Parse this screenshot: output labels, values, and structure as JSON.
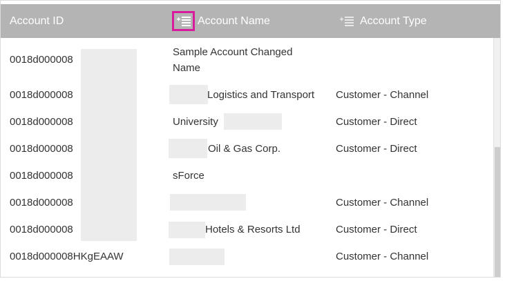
{
  "table": {
    "columns": [
      {
        "label": "Account ID",
        "sortable": false
      },
      {
        "label": "Account Name",
        "sortable": true
      },
      {
        "label": "Account Type",
        "sortable": true
      }
    ],
    "rows": [
      {
        "id": "0018d000008",
        "name": "Sample Account Changed Name",
        "type": ""
      },
      {
        "id": "0018d000008",
        "name": "Logistics and Transport",
        "type": "Customer - Channel"
      },
      {
        "id": "0018d000008",
        "name": "University",
        "type": "Customer - Direct"
      },
      {
        "id": "0018d000008",
        "name": "Oil & Gas Corp.",
        "type": "Customer - Direct"
      },
      {
        "id": "0018d000008",
        "name": "sForce",
        "type": ""
      },
      {
        "id": "0018d000008",
        "name": "",
        "type": "Customer - Channel"
      },
      {
        "id": "0018d000008",
        "name": "Hotels & Resorts Ltd",
        "type": "Customer - Direct"
      },
      {
        "id": "0018d000008HKgEAAW",
        "name": "",
        "type": "Customer - Channel"
      }
    ]
  },
  "colors": {
    "header_bg": "#b4b4b4",
    "header_text": "#ffffff",
    "highlight_border": "#d81b9c",
    "redaction": "#ececec"
  },
  "icons": {
    "sort_icon": "sort-list-icon"
  }
}
